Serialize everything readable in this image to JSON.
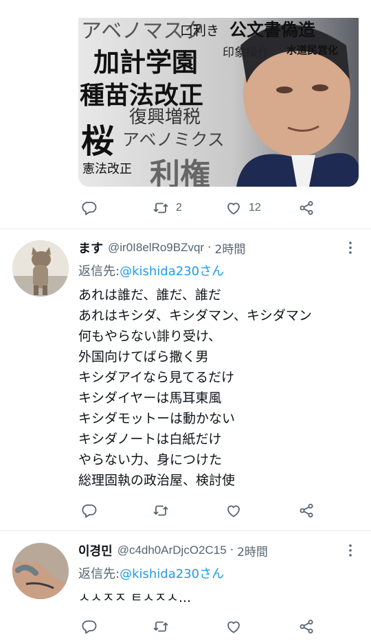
{
  "media_image": {
    "words": [
      "アベノマスク",
      "口利き",
      "公文書偽造",
      "印象操作",
      "水道民営化",
      "加計学園",
      "種苗法改正",
      "復興増税",
      "桜",
      "アベノミクス",
      "憲法改正",
      "利権"
    ]
  },
  "first_tweet_actions": {
    "reply_count": "",
    "retweet_count": "2",
    "like_count": "12"
  },
  "tweets": [
    {
      "display_name": "ます",
      "handle": "@ir0I8elRo9BZvqr",
      "separator": "·",
      "time": "2時間",
      "reply_label": "返信先:",
      "reply_to": "@kishida230さん",
      "lines": [
        "あれは誰だ、誰だ、誰だ",
        "あれはキシダ、キシダマン、キシダマン",
        "何もやらない誹り受け、",
        "外国向けてばら撒く男",
        "キシダアイなら見てるだけ",
        "キシダイヤーは馬耳東風",
        "キシダモットーは動かない",
        "キシダノートは白紙だけ",
        "やらない力、身につけた",
        "総理固執の政治屋、検討使"
      ]
    },
    {
      "display_name": "이경민",
      "handle": "@c4dh0ArDjcO2C15",
      "separator": "·",
      "time": "2時間",
      "reply_label": "返信先:",
      "reply_to": "@kishida230さん",
      "lines": [
        "ㅅㅅㅈㅈ ㅌㅅㅈㅅ..."
      ]
    }
  ],
  "colors": {
    "text": "#0f1419",
    "secondary": "#536471",
    "link": "#1d9bf0",
    "divider": "#e6e9eb"
  },
  "icons": [
    "reply-icon",
    "retweet-icon",
    "like-icon",
    "share-icon",
    "more-icon"
  ]
}
